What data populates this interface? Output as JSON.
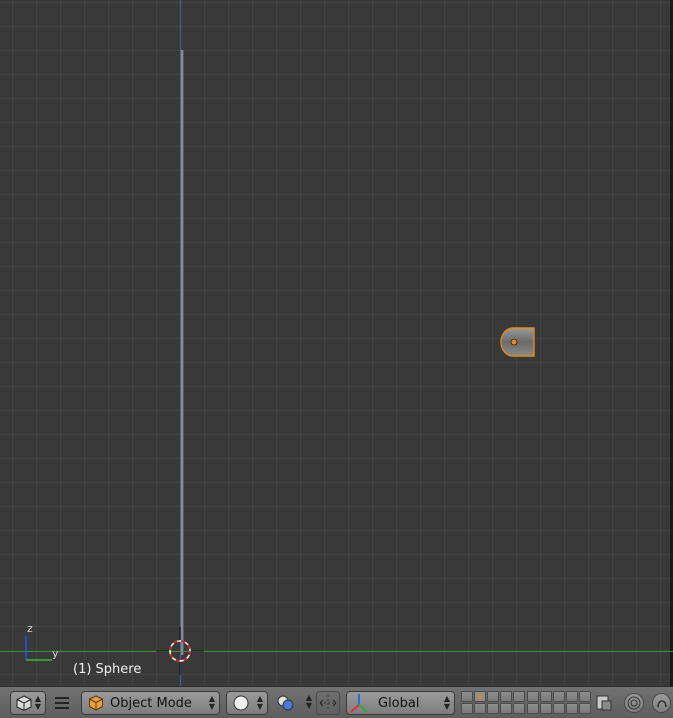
{
  "viewport": {
    "object_info": "(1) Sphere",
    "gizmo": {
      "z_label": "z",
      "y_label": "y"
    },
    "colors": {
      "background": "#393939",
      "z_axis": "#4a5fa8",
      "y_axis": "#3a8f34",
      "selection_outline": "#e08a1e"
    }
  },
  "header": {
    "editor_type_icon": "cube-icon",
    "menu_icon": "hamburger-menu-icon",
    "mode": {
      "icon": "object-cube-icon",
      "label": "Object Mode"
    },
    "shading": {
      "icon": "solid-sphere-icon"
    },
    "pivot": {
      "icon": "pivot-point-icon"
    },
    "manipulator": {
      "icon": "manipulator-icon"
    },
    "transform_orientation": {
      "icon": "transform-axes-icon",
      "label": "Global"
    },
    "layers_active_index": 1,
    "extra_icons": [
      "render-layer-icon",
      "proportional-edit-icon",
      "snap-icon"
    ]
  }
}
